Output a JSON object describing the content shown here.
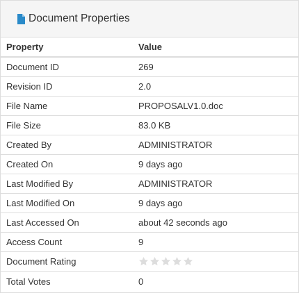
{
  "panel": {
    "title": "Document Properties",
    "icon": "document-icon"
  },
  "table": {
    "headers": {
      "property": "Property",
      "value": "Value"
    },
    "rows": [
      {
        "label": "Document ID",
        "value": "269"
      },
      {
        "label": "Revision ID",
        "value": "2.0"
      },
      {
        "label": "File Name",
        "value": "PROPOSALV1.0.doc"
      },
      {
        "label": "File Size",
        "value": "83.0 KB"
      },
      {
        "label": "Created By",
        "value": "ADMINISTRATOR"
      },
      {
        "label": "Created On",
        "value": "9 days ago"
      },
      {
        "label": "Last Modified By",
        "value": "ADMINISTRATOR"
      },
      {
        "label": "Last Modified On",
        "value": "9 days ago"
      },
      {
        "label": "Last Accessed On",
        "value": "about 42 seconds ago"
      },
      {
        "label": "Access Count",
        "value": "9"
      },
      {
        "label": "Document Rating",
        "rating": 0,
        "rating_max": 5
      },
      {
        "label": "Total Votes",
        "value": "0"
      }
    ]
  },
  "colors": {
    "icon_blue": "#2a8ac9",
    "star_empty": "#dddddd"
  }
}
